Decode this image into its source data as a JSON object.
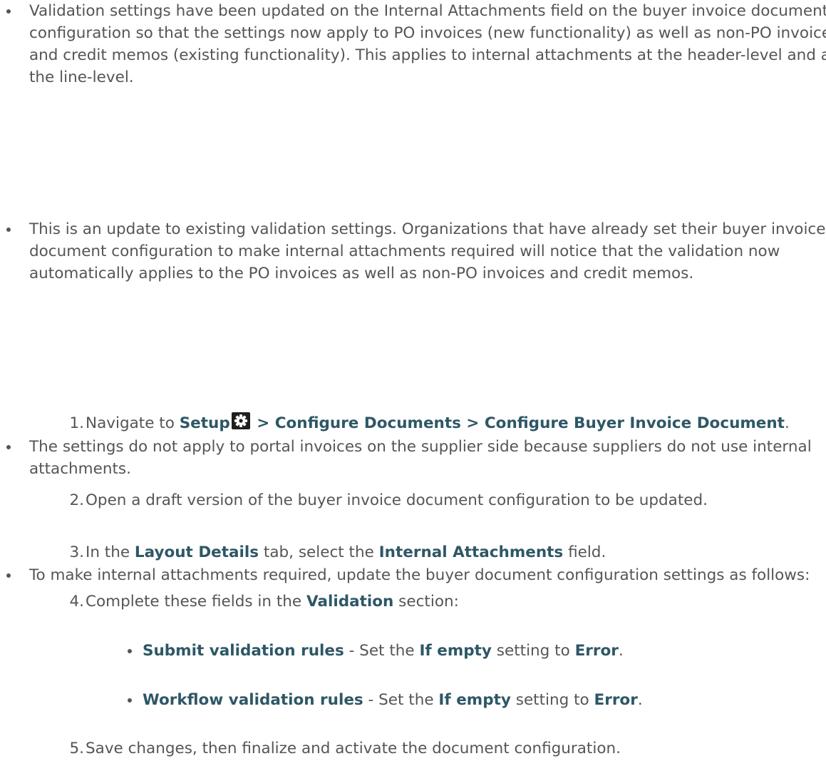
{
  "bullets": [
    "Validation settings have been updated on the Internal Attachments field on the buyer invoice document configuration so that the settings now apply to PO invoices (new functionality) as well as non-PO invoices and credit memos (existing functionality). This applies to internal attachments at the header-level and at the line-level.",
    "This is an update to existing validation settings. Organizations that have already set their buyer invoice document configuration to make internal attachments required will notice that the validation now automatically applies to the PO invoices as well as non-PO invoices and credit memos.",
    "The settings do not apply to portal invoices on the supplier side because suppliers do not use internal attachments.",
    "To make internal attachments required, update the buyer document configuration settings as follows:"
  ],
  "steps": {
    "s1": {
      "num": "1.",
      "pre": "Navigate to ",
      "setup": "Setup",
      "path": " > Configure Documents > Configure Buyer Invoice Document",
      "post": "."
    },
    "s2": {
      "num": "2.",
      "text": "Open a draft version of the buyer invoice document configuration to be updated."
    },
    "s3": {
      "num": "3.",
      "pre": "In the ",
      "tab": "Layout Details",
      "mid": " tab, select the ",
      "field": "Internal Attachments",
      "post": " field."
    },
    "s4": {
      "num": "4.",
      "pre": "Complete these fields in the ",
      "section": "Validation",
      "post": " section:"
    },
    "s5": {
      "num": "5.",
      "text": "Save changes, then finalize and activate the document configuration."
    }
  },
  "subitems": [
    {
      "rule": "Submit validation rules",
      "mid": " - Set the ",
      "setting": "If empty",
      "to": " setting to ",
      "value": "Error",
      "end": "."
    },
    {
      "rule": "Workflow validation rules",
      "mid": " - Set the ",
      "setting": "If empty",
      "to": " setting to ",
      "value": "Error",
      "end": "."
    }
  ],
  "icons": {
    "setup_icon": "gear-icon"
  },
  "colors": {
    "text": "#555555",
    "emphasis": "#2e5766"
  }
}
